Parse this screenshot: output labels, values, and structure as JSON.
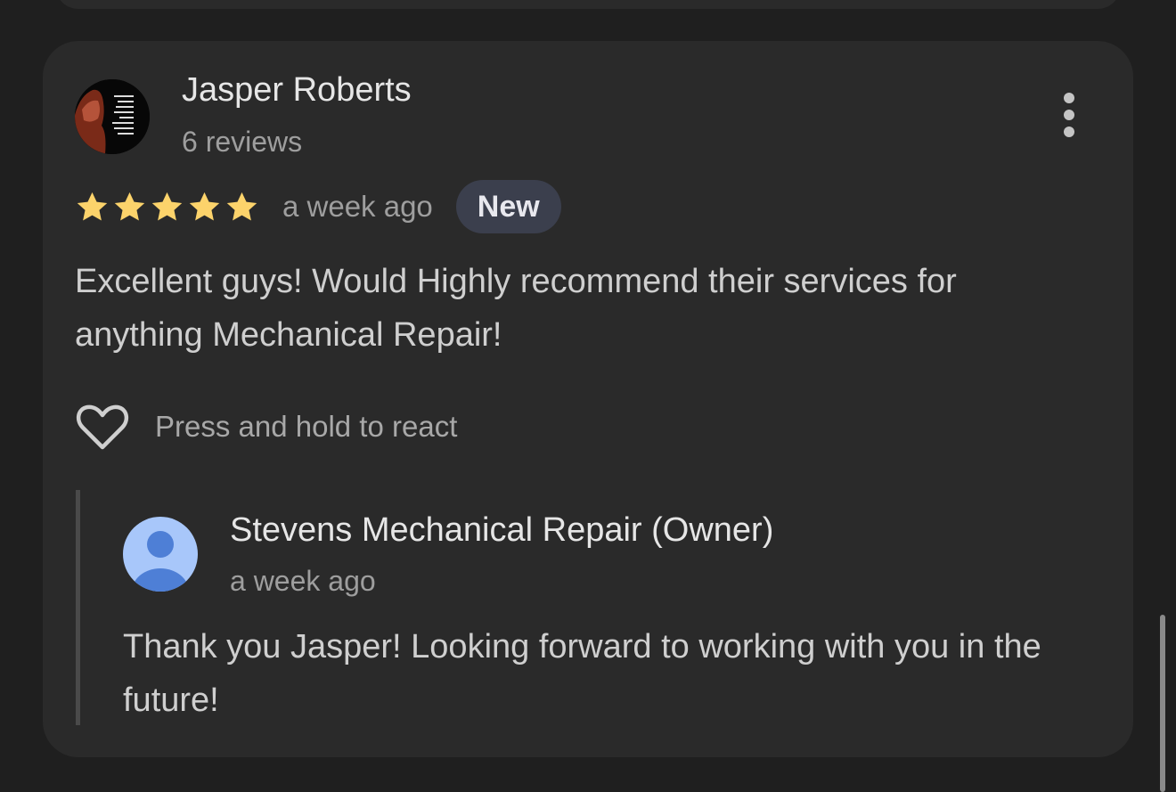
{
  "review": {
    "author_name": "Jasper Roberts",
    "author_reviews": "6 reviews",
    "avatar_icon": "profile-photo",
    "avatar_text": "The problem is not the problem. The problem is your attitude about the problem",
    "rating": 5,
    "rating_max": 5,
    "time": "a week ago",
    "badge": "New",
    "text": "Excellent guys! Would Highly recommend their services for anything Mechanical Repair!",
    "react_label": "Press and hold to react",
    "react_icon": "heart-outline-icon",
    "more_icon": "more-vertical-icon"
  },
  "owner_reply": {
    "name": "Stevens Mechanical Repair (Owner)",
    "time": "a week ago",
    "text": "Thank you Jasper! Looking forward to working with you in the future!",
    "avatar_icon": "default-person-avatar"
  },
  "colors": {
    "background": "#1f1f1f",
    "card": "#2a2a2a",
    "star": "#fcd36b",
    "badge_bg": "#3b3f4d",
    "owner_avatar_bg": "#a8c7fa",
    "owner_avatar_fg": "#4e7fd6"
  }
}
